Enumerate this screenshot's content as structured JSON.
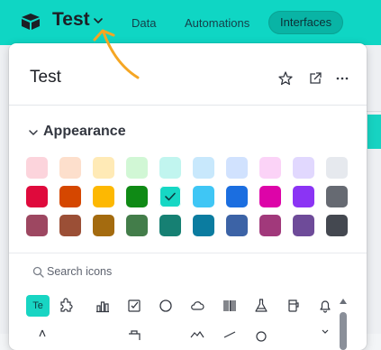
{
  "topbar": {
    "base_name": "Test",
    "tabs": [
      {
        "label": "Data",
        "active": false
      },
      {
        "label": "Automations",
        "active": false
      },
      {
        "label": "Interfaces",
        "active": true
      }
    ],
    "color": "#0fd6c4"
  },
  "popover": {
    "title": "Test",
    "header_icons": [
      "star-icon",
      "open-external-icon",
      "more-icon"
    ],
    "appearance": {
      "label": "Appearance",
      "selected_color": "#16d7c4",
      "colors": [
        [
          "#fcd4dc",
          "#fddfcc",
          "#ffeab6",
          "#d1f7d5",
          "#c1f5ef",
          "#c8e8fc",
          "#d1e2fe",
          "#fbd3f7",
          "#e1d8fe",
          "#e6e9ee"
        ],
        [
          "#df0a3c",
          "#d54700",
          "#fdb802",
          "#0f8a15",
          "#16d7c4",
          "#3fc6f5",
          "#1b6ee0",
          "#dd04a8",
          "#8b34f4",
          "#666a72"
        ],
        [
          "#9d4761",
          "#9b4f36",
          "#a46b0f",
          "#437d4a",
          "#168073",
          "#0b7ca0",
          "#3c63a6",
          "#a1397b",
          "#6e4b99",
          "#444850"
        ]
      ]
    },
    "search": {
      "placeholder": "Search icons",
      "value": ""
    },
    "icons": {
      "selected_label": "Te",
      "row1": [
        "puzzle-icon",
        "bar-chart-icon",
        "checkbox-icon",
        "circle-icon",
        "cloud-icon",
        "barcode-icon",
        "flask-icon",
        "cup-icon",
        "bell-icon"
      ]
    }
  }
}
